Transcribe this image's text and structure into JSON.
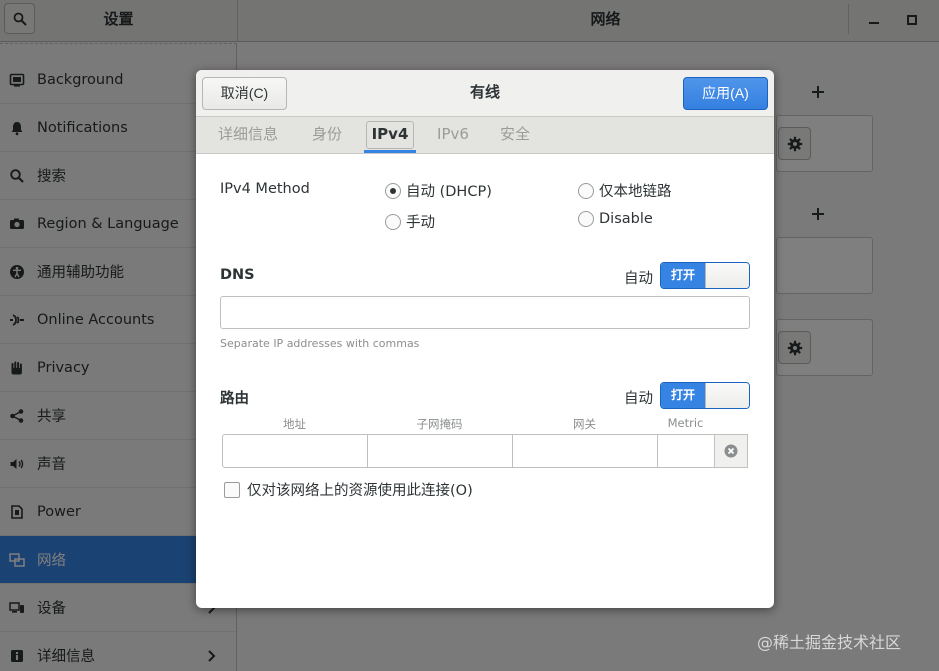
{
  "window": {
    "settings_title": "设置",
    "panel_title": "网络"
  },
  "sidebar": {
    "items": [
      {
        "label": "Background",
        "icon": "background-icon"
      },
      {
        "label": "Notifications",
        "icon": "bell-icon"
      },
      {
        "label": "搜索",
        "icon": "search-icon"
      },
      {
        "label": "Region & Language",
        "icon": "camera-icon"
      },
      {
        "label": "通用辅助功能",
        "icon": "accessibility-icon"
      },
      {
        "label": "Online Accounts",
        "icon": "online-accounts-icon"
      },
      {
        "label": "Privacy",
        "icon": "hand-icon"
      },
      {
        "label": "共享",
        "icon": "share-icon"
      },
      {
        "label": "声音",
        "icon": "speaker-icon"
      },
      {
        "label": "Power",
        "icon": "power-icon"
      },
      {
        "label": "网络",
        "icon": "network-icon",
        "active": true
      },
      {
        "label": "设备",
        "icon": "devices-icon",
        "has_arrow": true
      },
      {
        "label": "详细信息",
        "icon": "info-icon",
        "has_arrow": true
      }
    ]
  },
  "dialog": {
    "cancel_label": "取消(C)",
    "title": "有线",
    "apply_label": "应用(A)",
    "tabs": [
      {
        "label": "详细信息"
      },
      {
        "label": "身份"
      },
      {
        "label": "IPv4",
        "active": true
      },
      {
        "label": "IPv6"
      },
      {
        "label": "安全"
      }
    ],
    "ipv4_method": {
      "label": "IPv4 Method",
      "options": [
        {
          "label": "自动 (DHCP)",
          "selected": true
        },
        {
          "label": "仅本地链路",
          "selected": false
        },
        {
          "label": "手动",
          "selected": false
        },
        {
          "label": "Disable",
          "selected": false
        }
      ]
    },
    "dns": {
      "label": "DNS",
      "auto_label": "自动",
      "switch_label": "打开",
      "value": "",
      "hint": "Separate IP addresses with commas"
    },
    "routes": {
      "label": "路由",
      "auto_label": "自动",
      "switch_label": "打开",
      "columns": [
        "地址",
        "子网掩码",
        "网关",
        "Metric"
      ]
    },
    "only_local_resources": {
      "label": "仅对该网络上的资源使用此连接(O)",
      "checked": false
    }
  },
  "watermark": "@稀土掘金技术社区",
  "colors": {
    "accent": "#3584e4",
    "dim_overlay": "rgba(0,0,0,0.5)"
  }
}
